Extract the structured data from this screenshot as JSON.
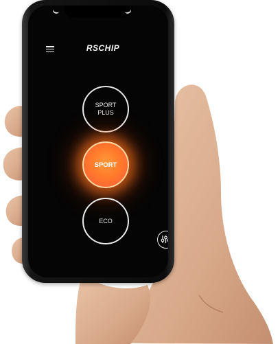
{
  "app": {
    "brand": "RSCHIP"
  },
  "modes": [
    {
      "label": "SPORT\nPLUS",
      "active": false
    },
    {
      "label": "SPORT",
      "active": true
    },
    {
      "label": "ECO",
      "active": false
    }
  ],
  "icons": {
    "menu": "hamburger-menu-icon",
    "settings": "sliders-icon"
  },
  "colors": {
    "screen_bg": "#050505",
    "active_glow": "#ff7a2b",
    "ring": "#e9e9e9"
  }
}
